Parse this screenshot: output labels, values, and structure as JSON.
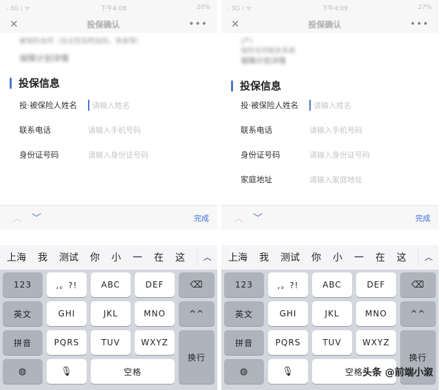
{
  "left": {
    "status_left": "ᵢ 3G ⁞ ᯤ",
    "status_time": "下午4:08",
    "status_right": "20%",
    "nav_title": "投保确认",
    "nav_more": "•••",
    "blur_lines": [
      "被保险合同（含主险及附加险，条款等）",
      "保障计划详情"
    ],
    "section_title": "投保信息",
    "fields": [
      {
        "label": "投·被保险人姓名",
        "placeholder": "请输入姓名"
      },
      {
        "label": "联系电话",
        "placeholder": "请输入手机号码"
      },
      {
        "label": "身份证号码",
        "placeholder": "请输入身份证号码"
      }
    ],
    "done_label": "完成",
    "candidates": [
      "上海",
      "我",
      "测试",
      "你",
      "小",
      "一",
      "在",
      "这"
    ]
  },
  "right": {
    "status_left": "ᵢ 3G ⁞ ᯤ",
    "status_time": "下午4:09",
    "status_right": "27%",
    "nav_title": "投保确认",
    "nav_more": "•••",
    "blur_lines": [
      "(产)",
      "保险合同相关条款",
      "保障计划详情"
    ],
    "section_title": "投保信息",
    "fields": [
      {
        "label": "投·被保险人姓名",
        "placeholder": "请输入姓名"
      },
      {
        "label": "联系电话",
        "placeholder": "请输入手机号码"
      },
      {
        "label": "身份证号码",
        "placeholder": "请输入身份证号码"
      },
      {
        "label": "家庭地址",
        "placeholder": "请输入家庭地址"
      }
    ],
    "done_label": "完成",
    "candidates": [
      "上海",
      "我",
      "测试",
      "你",
      "小",
      "一",
      "在",
      "这"
    ]
  },
  "keyboard": {
    "k123": "123",
    "punct": ",。?!",
    "abc": "ABC",
    "def": "DEF",
    "english": "英文",
    "ghi": "GHI",
    "jkl": "JKL",
    "mno": "MNO",
    "emoji": "^^",
    "pinyin": "拼音",
    "pqrs": "PQRS",
    "tuv": "TUV",
    "wxyz": "WXYZ",
    "enter": "换行",
    "space": "空格"
  },
  "watermark": "头条 @前端小溆"
}
